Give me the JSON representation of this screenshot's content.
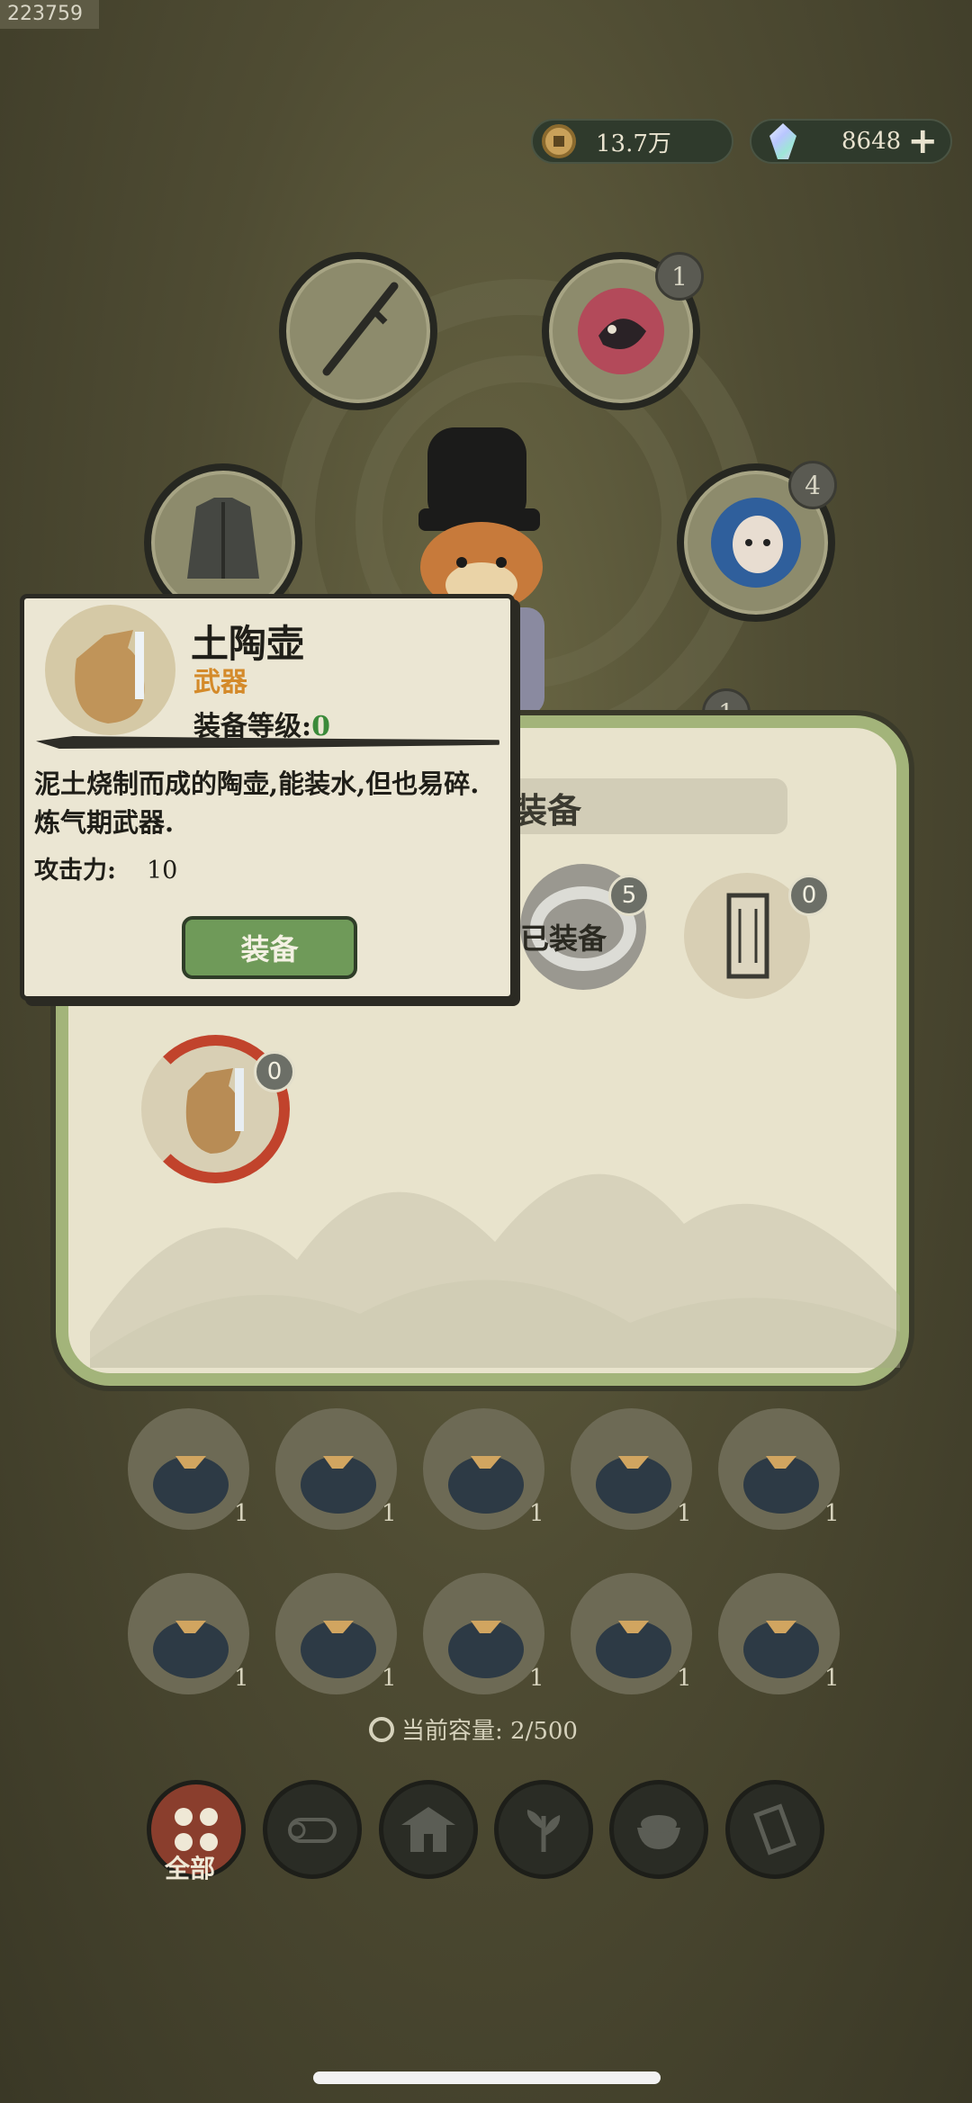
{
  "debug_id": "223759",
  "currency": {
    "coins": "13.7万",
    "gems": "8648",
    "add_label": "+"
  },
  "slots": {
    "dragon_count": "1",
    "ghost_count": "4",
    "hidden_count": "1"
  },
  "panel": {
    "title": "装备",
    "ring_count": "5",
    "equipped_label": "已装备",
    "scroll_count": "0",
    "pot_count": "0"
  },
  "bags": [
    {
      "count": "1"
    },
    {
      "count": "1"
    },
    {
      "count": "1"
    },
    {
      "count": "1"
    },
    {
      "count": "1"
    },
    {
      "count": "1"
    },
    {
      "count": "1"
    },
    {
      "count": "1"
    },
    {
      "count": "1"
    },
    {
      "count": "1"
    }
  ],
  "capacity": {
    "label": "当前容量: 2/500"
  },
  "tabs": {
    "all_label": "全部"
  },
  "tooltip": {
    "name": "土陶壶",
    "type": "武器",
    "level_label": "装备等级:",
    "level_value": "0",
    "description": "泥土烧制而成的陶壶,能装水,但也易碎.炼气期武器.",
    "attack_label": "攻击力:",
    "attack_value": "10",
    "equip_button": "装备"
  },
  "colors": {
    "panel_border": "#a3b47a",
    "equip_button": "#6f9a59",
    "weapon_type": "#d48a2a",
    "level_value": "#3b8a3a",
    "active_tab": "#8a3e2d"
  }
}
